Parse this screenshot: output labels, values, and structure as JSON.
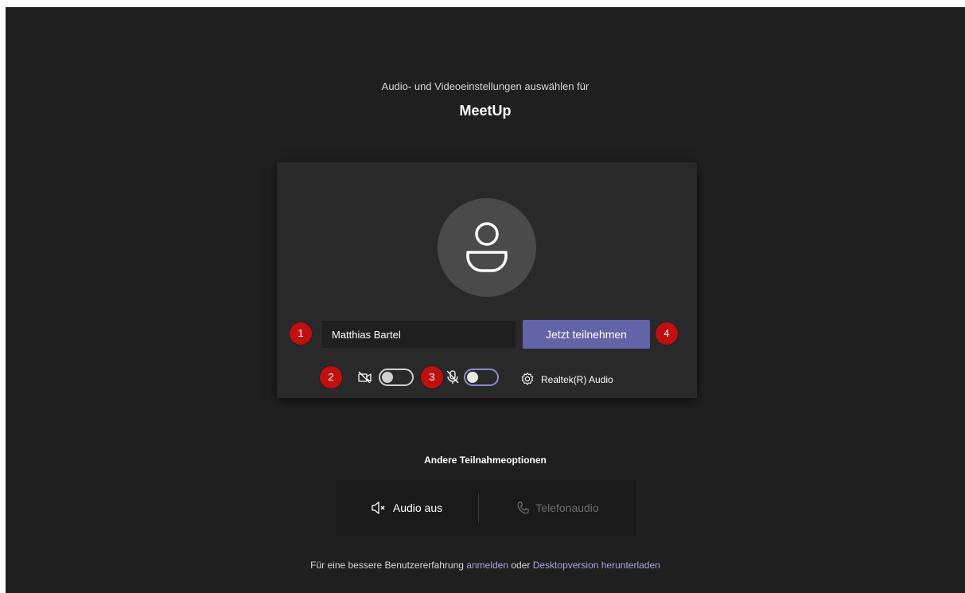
{
  "header": {
    "subtitle": "Audio- und Videoeinstellungen auswählen für",
    "meeting_title": "MeetUp"
  },
  "prejoin": {
    "name_value": "Matthias Bartel",
    "join_label": "Jetzt teilnehmen",
    "video_toggle": "off",
    "mic_toggle": "off",
    "device_label": "Realtek(R) Audio",
    "badges": [
      "1",
      "2",
      "3",
      "4"
    ]
  },
  "other_options": {
    "title": "Andere Teilnahmeoptionen",
    "audio_off_label": "Audio aus",
    "phone_audio_label": "Telefonaudio"
  },
  "footer": {
    "prefix": "Für eine bessere Benutzererfahrung",
    "sign_in_link": "anmelden",
    "middle": "oder",
    "download_link": "Desktopversion herunterladen"
  },
  "colors": {
    "background": "#1f1f1f",
    "card": "#292929",
    "accent": "#6264a7",
    "badge": "#c10e0e",
    "link": "#a6a7dc"
  }
}
